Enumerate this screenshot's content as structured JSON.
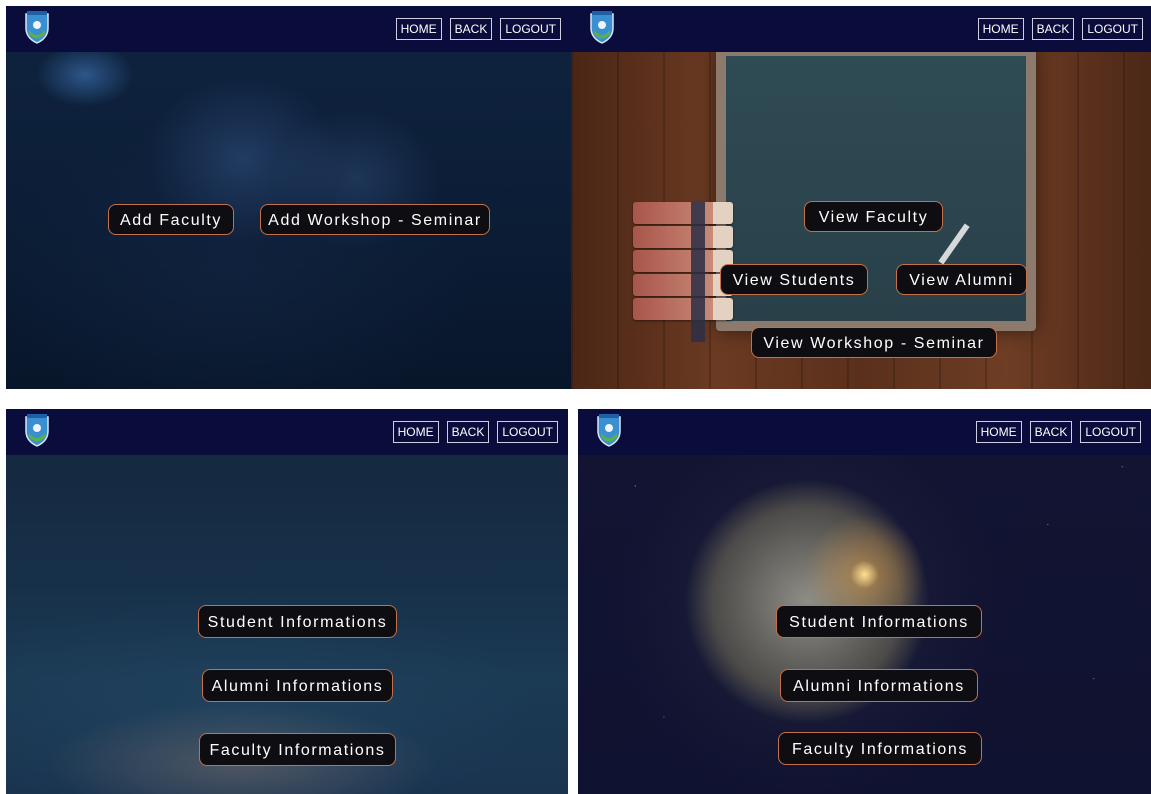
{
  "nav": {
    "home": "HOME",
    "back": "BACK",
    "logout": "LOGOUT"
  },
  "panel1": {
    "buttons": [
      "Add Faculty",
      "Add Workshop - Seminar"
    ]
  },
  "panel2": {
    "buttons": [
      "View Faculty",
      "View Students",
      "View Alumni",
      "View Workshop - Seminar"
    ]
  },
  "panel3": {
    "buttons": [
      "Student Informations",
      "Alumni Informations",
      "Faculty Informations"
    ]
  },
  "panel4": {
    "buttons": [
      "Student Informations",
      "Alumni Informations",
      "Faculty Informations"
    ]
  },
  "colors": {
    "navbar": "#0a0c3c",
    "button_bg": "#0e0d12",
    "button_border": "#c4704a"
  },
  "icons": {
    "logo": "university-shield-logo"
  }
}
